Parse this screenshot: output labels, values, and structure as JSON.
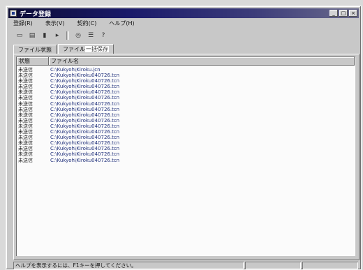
{
  "window": {
    "title": "データ登録",
    "controls": {
      "minimize": "_",
      "maximize": "□",
      "close": "×"
    }
  },
  "menubar": {
    "items": [
      "登録(R)",
      "表示(V)",
      "契約(C)",
      "ヘルプ(H)"
    ]
  },
  "toolbar": {
    "buttons": [
      {
        "icon": "new-icon",
        "glyph": "▭"
      },
      {
        "icon": "open-icon",
        "glyph": "▤"
      },
      {
        "icon": "save-icon",
        "glyph": "▮"
      },
      {
        "icon": "arrow-icon",
        "glyph": "▸"
      },
      {
        "icon": "search-icon",
        "glyph": "◎"
      },
      {
        "icon": "list-icon",
        "glyph": "☰"
      },
      {
        "icon": "help-icon",
        "glyph": "?"
      }
    ]
  },
  "tabs": {
    "items": [
      {
        "label": "ファイル状態"
      },
      {
        "label": "ファイル",
        "highlight": "一括保存",
        "suffix": ""
      }
    ]
  },
  "list": {
    "columns": {
      "status": "状態",
      "name": "ファイル名"
    },
    "rows": [
      {
        "status": "未送信",
        "name": "C:\\Kukyoh\\Kiroku.jcn"
      },
      {
        "status": "未送信",
        "name": "C:\\Kukyoh\\Kiroku040726.tcn"
      },
      {
        "status": "未送信",
        "name": "C:\\Kukyoh\\Kiroku040726.tcn"
      },
      {
        "status": "未送信",
        "name": "C:\\Kukyoh\\Kiroku040726.tcn"
      },
      {
        "status": "未送信",
        "name": "C:\\Kukyoh\\Kiroku040726.tcn"
      },
      {
        "status": "未送信",
        "name": "C:\\Kukyoh\\Kiroku040726.tcn"
      },
      {
        "status": "未送信",
        "name": "C:\\Kukyoh\\Kiroku040726.tcn"
      },
      {
        "status": "未送信",
        "name": "C:\\Kukyoh\\Kiroku040726.tcn"
      },
      {
        "status": "未送信",
        "name": "C:\\Kukyoh\\Kiroku040726.tcn"
      },
      {
        "status": "未送信",
        "name": "C:\\Kukyoh\\Kiroku040726.tcn"
      },
      {
        "status": "未送信",
        "name": "C:\\Kukyoh\\Kiroku040726.tcn"
      },
      {
        "status": "未送信",
        "name": "C:\\Kukyoh\\Kiroku040726.tcn"
      },
      {
        "status": "未送信",
        "name": "C:\\Kukyoh\\Kiroku040726.tcn"
      },
      {
        "status": "未送信",
        "name": "C:\\Kukyoh\\Kiroku040726.tcn"
      },
      {
        "status": "未送信",
        "name": "C:\\Kukyoh\\Kiroku040726.tcn"
      },
      {
        "status": "未送信",
        "name": "C:\\Kukyoh\\Kiroku040726.tcn"
      },
      {
        "status": "未送信",
        "name": "C:\\Kukyoh\\Kiroku040726.tcn"
      }
    ]
  },
  "statusbar": {
    "message": "ヘルプを表示するには、F1キーを押してください。"
  },
  "colors": {
    "titlebar_start": "#0b0b35",
    "titlebar_end": "#6a6a8c",
    "list_bg": "#fbfbfb",
    "filename_text": "#1f2f7a"
  }
}
